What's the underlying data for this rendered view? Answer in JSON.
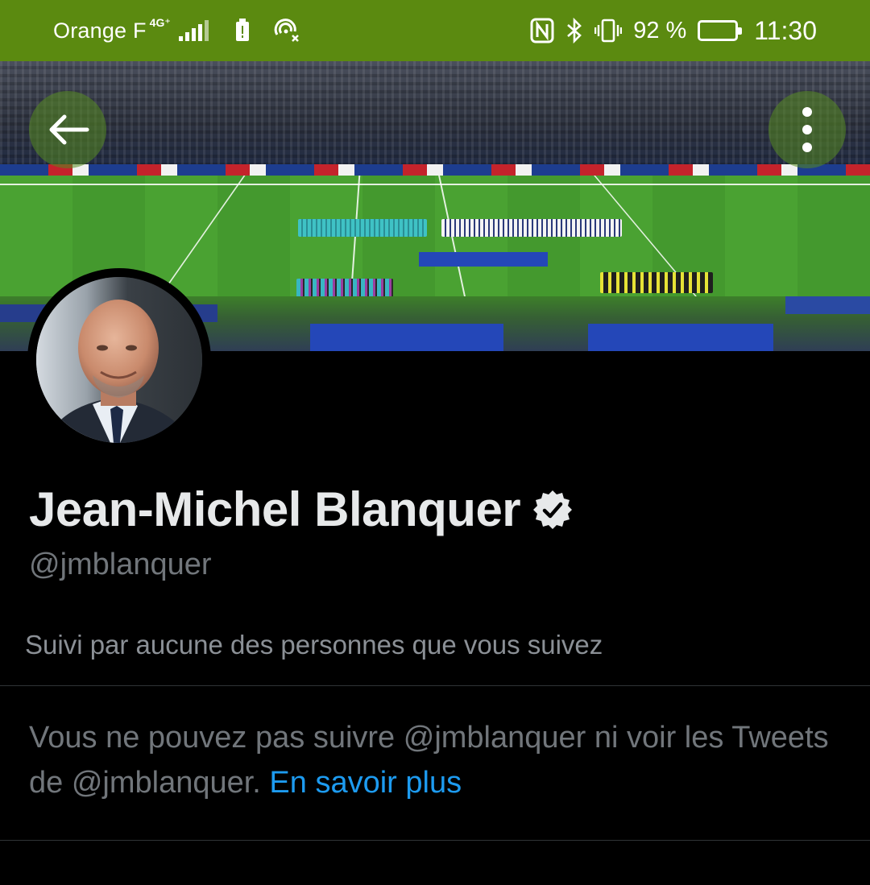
{
  "status_bar": {
    "carrier": "Orange F",
    "network": "4G⁺",
    "battery_percent": "92 %",
    "battery_level": 0.92,
    "time": "11:30",
    "background_color": "#5b8a10",
    "icons": [
      "signal-icon",
      "battery-alert-icon",
      "hotspot-icon",
      "nfc-icon",
      "bluetooth-icon",
      "vibrate-icon",
      "battery-icon"
    ]
  },
  "header": {
    "back_icon": "arrow-left-icon",
    "more_icon": "more-vertical-icon",
    "button_color": "#568a20"
  },
  "profile": {
    "name": "Jean-Michel Blanquer",
    "verified_icon": "verified-badge-icon",
    "handle": "@jmblanquer",
    "followed_by": "Suivi par aucune des personnes que vous suivez",
    "notice_text": "Vous ne pouvez pas suivre @jmblanquer ni voir les Tweets de @jmblanquer.",
    "learn_more": "En savoir plus",
    "link_color": "#1d9bf0"
  }
}
